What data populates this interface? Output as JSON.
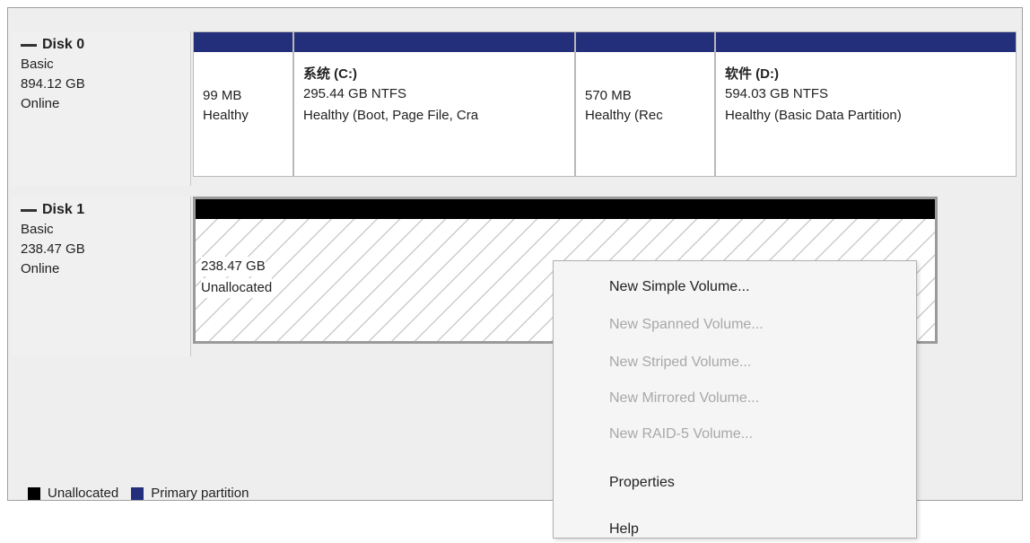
{
  "disks": [
    {
      "name": "Disk 0",
      "type": "Basic",
      "size": "894.12 GB",
      "status": "Online",
      "partitions": [
        {
          "title": "",
          "size": "99 MB",
          "status": "Healthy",
          "kind": "primary"
        },
        {
          "title": "系统 (C:)",
          "size": "295.44 GB NTFS",
          "status": "Healthy (Boot, Page File, Cra",
          "kind": "primary"
        },
        {
          "title": "",
          "size": "570 MB",
          "status": "Healthy (Rec",
          "kind": "primary"
        },
        {
          "title": "软件 (D:)",
          "size": "594.03 GB NTFS",
          "status": "Healthy (Basic Data Partition)",
          "kind": "primary"
        }
      ]
    },
    {
      "name": "Disk 1",
      "type": "Basic",
      "size": "238.47 GB",
      "status": "Online",
      "partitions": [
        {
          "title": "",
          "size": "238.47 GB",
          "status": "Unallocated",
          "kind": "unallocated"
        }
      ]
    }
  ],
  "legend": {
    "unallocated": "Unallocated",
    "primary": "Primary partition",
    "colors": {
      "unallocated": "#000000",
      "primary": "#232f7a"
    }
  },
  "context_menu": {
    "items": [
      {
        "label": "New Simple Volume...",
        "enabled": true
      },
      {
        "label": "New Spanned Volume...",
        "enabled": false
      },
      {
        "label": "New Striped Volume...",
        "enabled": false
      },
      {
        "label": "New Mirrored Volume...",
        "enabled": false
      },
      {
        "label": "New RAID-5 Volume...",
        "enabled": false
      },
      {
        "label": "Properties",
        "enabled": true
      },
      {
        "label": "Help",
        "enabled": true
      }
    ]
  }
}
